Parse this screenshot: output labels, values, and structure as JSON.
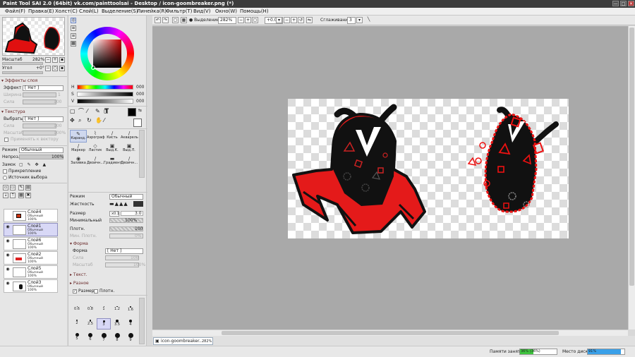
{
  "window": {
    "title": "Paint Tool SAI 2.0 (64bit) vk.com/painttoolsai - Desktop / icon-goombreaker.png (*)",
    "minimize": "—",
    "maximize": "□",
    "close": "✕"
  },
  "menu": {
    "items": [
      "Файл(F)",
      "Правка(E)",
      "Холст(C)",
      "Слой(L)",
      "Выделение(S)",
      "Линейка(R)",
      "Фильтр(T)",
      "Вид(V)",
      "Окно(W)",
      "Помощь(H)"
    ]
  },
  "toolbar": {
    "selection_label": "Выделение",
    "zoom_value": "282%",
    "rotation_value": "+0.0°",
    "smoothing_label": "Сглаживание",
    "smoothing_value": "3",
    "zoom_minus": "−",
    "zoom_plus": "+",
    "rot_minus": "−",
    "rot_plus": "+"
  },
  "navigator": {
    "zoom_label": "Масштаб",
    "zoom_value": "282%",
    "angle_label": "Угол",
    "angle_value": "+0°"
  },
  "layer_effects": {
    "header": "Эффекты слоя",
    "effect_label": "Эффект",
    "effect_value": "[ Нет ]",
    "width_label": "Ширина",
    "width_value": "1",
    "power_label": "Сила",
    "power_value": "100"
  },
  "texture": {
    "header": "Текстура",
    "select_label": "Выбрать",
    "select_value": "[ Нет ]",
    "power_label": "Сила",
    "power_value": "100",
    "scale_label": "Масштаб",
    "scale_value": "100%",
    "apply_vector": "Применять к вектору"
  },
  "layer_props": {
    "mode_label": "Режим",
    "mode_value": "Обычный",
    "opacity_label": "Непроз.",
    "opacity_value": "100%",
    "lock_label": "Замок",
    "clip_label": "Прикрепление",
    "source_label": "Источник выбора"
  },
  "layers": [
    {
      "name": "Слой4",
      "mode": "Обычный",
      "opacity": "100%",
      "visible": false,
      "selected": false
    },
    {
      "name": "Слой1",
      "mode": "Обычный",
      "opacity": "100%",
      "visible": true,
      "selected": true
    },
    {
      "name": "Слой6",
      "mode": "Обычный",
      "opacity": "100%",
      "visible": true,
      "selected": false
    },
    {
      "name": "Слой2",
      "mode": "Обычный",
      "opacity": "100%",
      "visible": true,
      "selected": false
    },
    {
      "name": "Слой5",
      "mode": "Обычный",
      "opacity": "100%",
      "visible": true,
      "selected": false
    },
    {
      "name": "Слой3",
      "mode": "Обычный",
      "opacity": "100%",
      "visible": true,
      "selected": false
    }
  ],
  "color": {
    "h_label": "H",
    "h_value": "000",
    "s_label": "S",
    "s_value": "000",
    "v_label": "V",
    "v_value": "000",
    "primary": "#000000",
    "secondary": "#ffffff"
  },
  "tools": [
    {
      "name": "Каранд.",
      "sel": true,
      "icon": "✎"
    },
    {
      "name": "Аэрограф",
      "sel": false,
      "icon": "⌇"
    },
    {
      "name": "Кисть",
      "sel": false,
      "icon": "/"
    },
    {
      "name": "Акварель",
      "sel": false,
      "icon": "/"
    },
    {
      "name": "Маркер",
      "sel": false,
      "icon": "/"
    },
    {
      "name": "Ластик",
      "sel": false,
      "icon": "◇"
    },
    {
      "name": "Выд.К.",
      "sel": false,
      "icon": "▣"
    },
    {
      "name": "Выд.Л.",
      "sel": false,
      "icon": "▣"
    },
    {
      "name": "Заливка",
      "sel": false,
      "icon": "◉"
    },
    {
      "name": "Двоичн...",
      "sel": false,
      "icon": "/"
    },
    {
      "name": "Градиент",
      "sel": false,
      "icon": "▬"
    },
    {
      "name": "Двоичн...",
      "sel": false,
      "icon": "/"
    }
  ],
  "brush": {
    "mode_label": "Режим",
    "mode_value": "Обычный",
    "hardness_label": "Жесткость",
    "size_label": "Размер",
    "size_mult": "x0.1",
    "size_value": "3.0",
    "min_label": "Минимальный",
    "min_value": "100%",
    "density_label": "Плотн.",
    "density_value": "100",
    "min_density_label": "Мин. Плотн.",
    "min_density_value": "0%",
    "shape_header": "Форма",
    "shape_label": "Форма",
    "shape_value": "[ Нет ]",
    "shape_power_label": "Сила",
    "shape_power_value": "100",
    "shape_scale_label": "Масштаб",
    "shape_scale_value": "100%",
    "texture_header": "Текст.",
    "misc_header": "Разное",
    "size_check": "Размер",
    "density_check": "Плотн."
  },
  "brush_sizes": {
    "rows": [
      [
        "0.6",
        "0.8",
        "1",
        "1.2",
        "1.6"
      ],
      [
        "2",
        "2.5",
        "3",
        "3.5",
        "4"
      ],
      [
        "5",
        "6",
        "7",
        "8",
        "9"
      ]
    ],
    "selected": "3"
  },
  "canvas_tab": {
    "name": "icon-goombreaker...",
    "zoom": "282%"
  },
  "status": {
    "memory_label": "Памяти занято",
    "memory_value": "36% (36%)",
    "memory_fraction": 0.36,
    "disk_label": "Место диска",
    "disk_value": "91%",
    "disk_fraction": 0.91
  }
}
